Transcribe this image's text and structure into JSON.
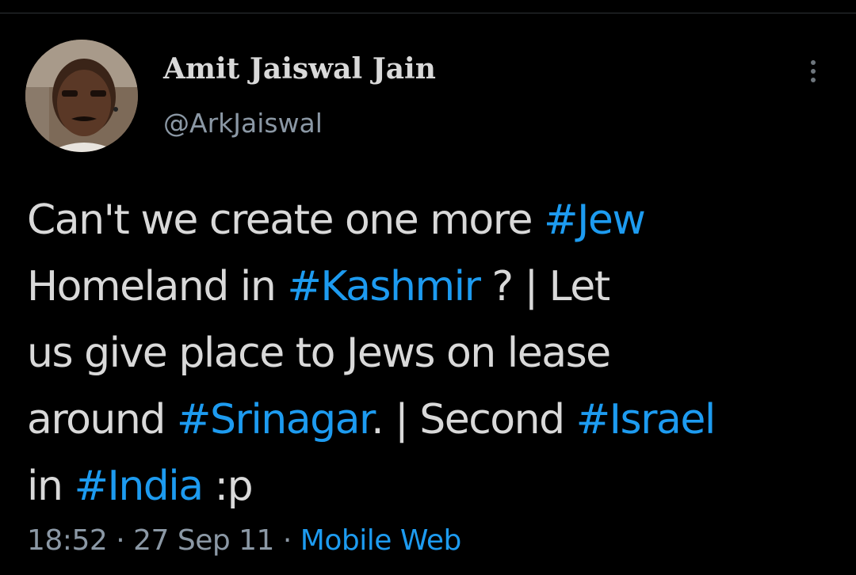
{
  "author": {
    "display_name": "Amit Jaiswal Jain",
    "handle": "@ArkJaiswal"
  },
  "tweet": {
    "lines": [
      [
        {
          "text": "Can't we create one more ",
          "type": "text"
        },
        {
          "text": "#Jew",
          "type": "hashtag"
        }
      ],
      [
        {
          "text": "Homeland in ",
          "type": "text"
        },
        {
          "text": "#Kashmir",
          "type": "hashtag"
        },
        {
          "text": " ? | Let",
          "type": "text"
        }
      ],
      [
        {
          "text": "us give place to Jews on lease",
          "type": "text"
        }
      ],
      [
        {
          "text": "around ",
          "type": "text"
        },
        {
          "text": "#Srinagar",
          "type": "hashtag"
        },
        {
          "text": ". | Second ",
          "type": "text"
        },
        {
          "text": "#Israel",
          "type": "hashtag"
        }
      ],
      [
        {
          "text": "in ",
          "type": "text"
        },
        {
          "text": "#India",
          "type": "hashtag"
        },
        {
          "text": " :p",
          "type": "text"
        }
      ]
    ]
  },
  "meta": {
    "time": "18:52",
    "separator": " · ",
    "date": "27 Sep 11",
    "source": "Mobile Web"
  },
  "icons": {
    "more": "more-vertical-icon",
    "avatar": "profile-photo"
  },
  "colors": {
    "background": "#000000",
    "text": "#d9d9d9",
    "secondary_text": "#8b98a5",
    "link": "#1d9bf0"
  }
}
